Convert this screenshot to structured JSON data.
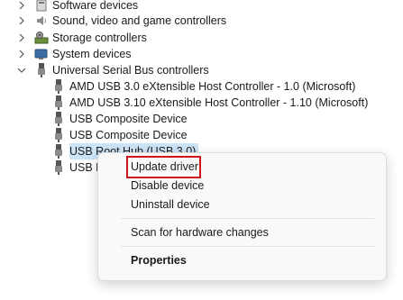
{
  "tree": {
    "items": [
      {
        "label": "Software devices",
        "expander": "chevron-right",
        "icon": "software-device-icon"
      },
      {
        "label": "Sound, video and game controllers",
        "expander": "chevron-right",
        "icon": "speaker-icon"
      },
      {
        "label": "Storage controllers",
        "expander": "chevron-right",
        "icon": "storage-controller-icon"
      },
      {
        "label": "System devices",
        "expander": "chevron-right",
        "icon": "system-device-icon"
      },
      {
        "label": "Universal Serial Bus controllers",
        "expander": "chevron-down",
        "icon": "usb-plug-icon"
      },
      {
        "label": "AMD USB 3.0 eXtensible Host Controller - 1.0 (Microsoft)",
        "icon": "usb-plug-icon"
      },
      {
        "label": "AMD USB 3.10 eXtensible Host Controller - 1.10 (Microsoft)",
        "icon": "usb-plug-icon"
      },
      {
        "label": "USB Composite Device",
        "icon": "usb-plug-icon"
      },
      {
        "label": "USB Composite Device",
        "icon": "usb-plug-icon"
      },
      {
        "label": "USB Root Hub (USB 3.0)",
        "icon": "usb-plug-icon",
        "selected": true
      },
      {
        "label": "USB R",
        "icon": "usb-plug-icon"
      }
    ]
  },
  "context_menu": {
    "items": [
      {
        "label": "Update driver",
        "highlighted": true
      },
      {
        "label": "Disable device"
      },
      {
        "label": "Uninstall device"
      },
      {
        "label": "Scan for hardware changes"
      },
      {
        "label": "Properties",
        "bold": true
      }
    ],
    "highlight_color": "#d0141e"
  },
  "colors": {
    "selection": "#cce4f7",
    "menu_background": "#f9f9f9"
  }
}
